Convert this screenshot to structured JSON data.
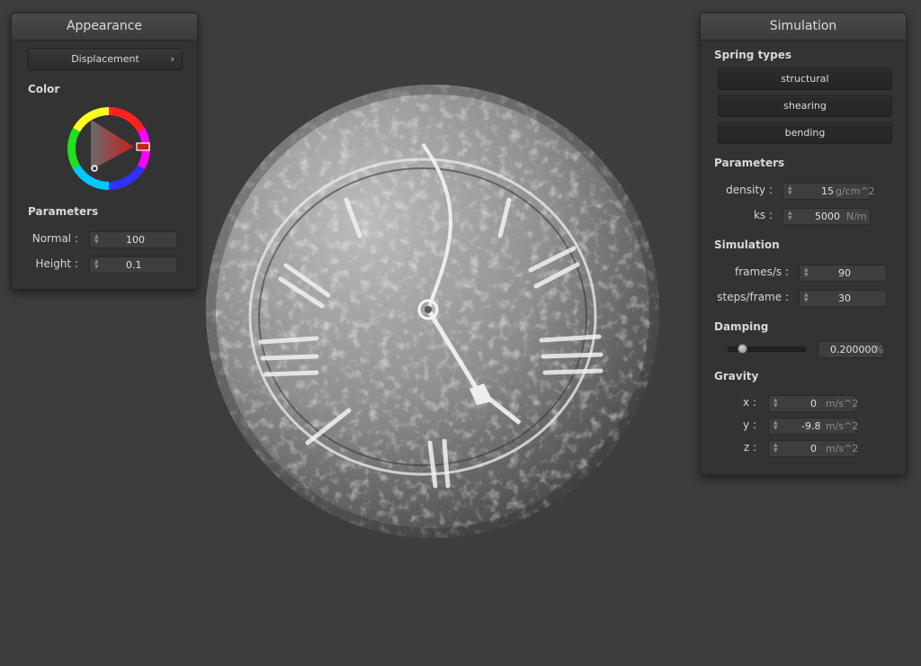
{
  "appearance": {
    "title": "Appearance",
    "shader_dropdown": "Displacement",
    "color_label": "Color",
    "params_label": "Parameters",
    "normal_label": "Normal :",
    "normal_value": "100",
    "height_label": "Height :",
    "height_value": "0.1"
  },
  "simulation": {
    "title": "Simulation",
    "spring_types_label": "Spring types",
    "spring_buttons": [
      "structural",
      "shearing",
      "bending"
    ],
    "params_label": "Parameters",
    "density_label": "density :",
    "density_value": "15",
    "density_unit": "g/cm^2",
    "ks_label": "ks :",
    "ks_value": "5000",
    "ks_unit": "N/m",
    "sim_label": "Simulation",
    "fps_label": "frames/s :",
    "fps_value": "90",
    "steps_label": "steps/frame :",
    "steps_value": "30",
    "damping_label": "Damping",
    "damping_value": "0.200000",
    "damping_unit": "%",
    "damping_level": 0.2,
    "gravity_label": "Gravity",
    "gx_label": "x :",
    "gx_value": "0",
    "gx_unit": "m/s^2",
    "gy_label": "y :",
    "gy_value": "-9.8",
    "gy_unit": "m/s^2",
    "gz_label": "z :",
    "gz_value": "0",
    "gz_unit": "m/s^2"
  },
  "colors": {
    "background": "#3d3d3d",
    "panel": "#333333",
    "selected_color": "#c81e1e"
  }
}
